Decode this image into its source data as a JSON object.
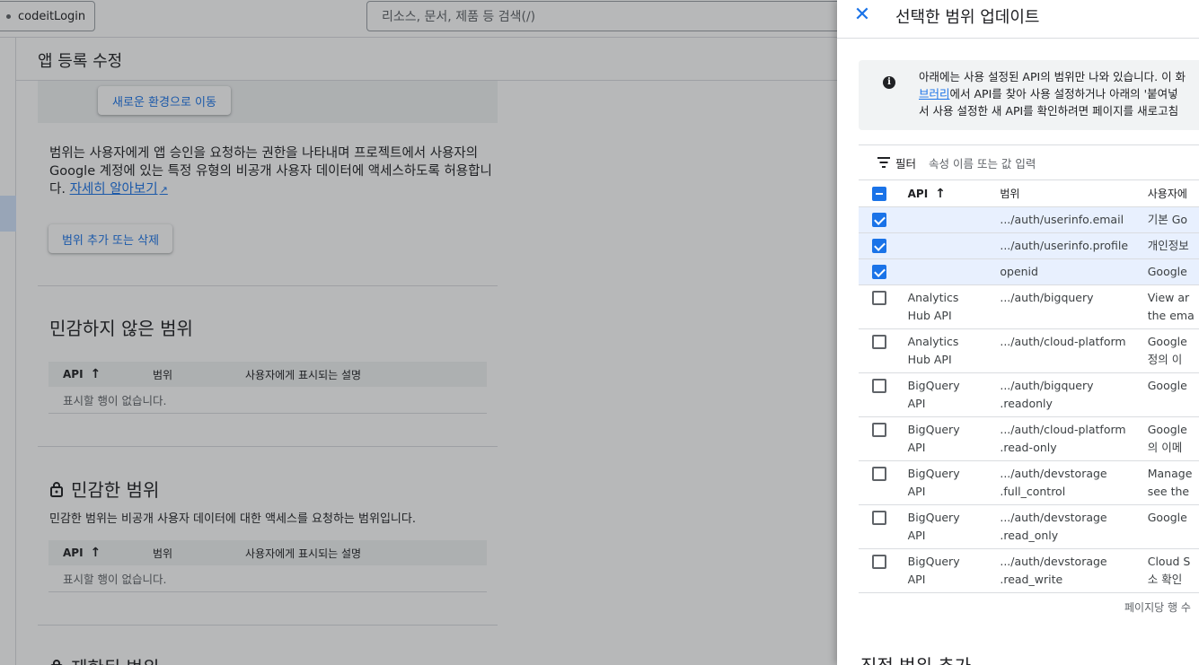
{
  "topbar": {
    "project_name": "codeitLogin",
    "search_placeholder": "리소스, 문서, 제품 등 검색(/)"
  },
  "page": {
    "title": "앱 등록 수정",
    "new_env_button": "새로운 환경으로 이동",
    "scope_description": "범위는 사용자에게 앱 승인을 요청하는 권한을 나타내며 프로젝트에서 사용자의 Google 계정에 있는 특정 유형의 비공개 사용자 데이터에 액세스하도록 허용합니다.",
    "learn_more": "자세히 알아보기",
    "add_remove_button": "범위 추가 또는 삭제",
    "nonsensitive": {
      "title": "민감하지 않은 범위",
      "headers": [
        "API",
        "범위",
        "사용자에게 표시되는 설명"
      ],
      "empty": "표시할 행이 없습니다."
    },
    "sensitive": {
      "title": "민감한 범위",
      "subtitle": "민감한 범위는 비공개 사용자 데이터에 대한 액세스를 요청하는 범위입니다.",
      "headers": [
        "API",
        "범위",
        "사용자에게 표시되는 설명"
      ],
      "empty": "표시할 행이 없습니다."
    },
    "restricted": {
      "title": "제한된 범위"
    }
  },
  "panel": {
    "title": "선택한 범위 업데이트",
    "info_line1": "아래에는 사용 설정된 API의 범위만 나와 있습니다. 이 화",
    "info_line2_link": "브러리",
    "info_line2_rest": "에서 API를 찾아 사용 설정하거나 아래의 '붙여넣",
    "info_line3": "서 사용 설정한 새 API를 확인하려면 페이지를 새로고침",
    "filter_label": "필터",
    "filter_placeholder": "속성 이름 또는 값 입력",
    "table_headers": {
      "api": "API",
      "scope": "범위",
      "desc": "사용자에"
    },
    "rows": [
      {
        "checked": true,
        "api1": "",
        "api2": "",
        "scope1": ".../auth/userinfo.email",
        "scope2": "",
        "desc1": "기본 Go",
        "desc2": ""
      },
      {
        "checked": true,
        "api1": "",
        "api2": "",
        "scope1": ".../auth/userinfo.profile",
        "scope2": "",
        "desc1": "개인정보",
        "desc2": ""
      },
      {
        "checked": true,
        "api1": "",
        "api2": "",
        "scope1": "openid",
        "scope2": "",
        "desc1": "Google",
        "desc2": ""
      },
      {
        "checked": false,
        "api1": "Analytics",
        "api2": "Hub API",
        "scope1": ".../auth/bigquery",
        "scope2": "",
        "desc1": "View ar",
        "desc2": "the ema"
      },
      {
        "checked": false,
        "api1": "Analytics",
        "api2": "Hub API",
        "scope1": ".../auth/cloud-platform",
        "scope2": "",
        "desc1": "Google",
        "desc2": "정의 이"
      },
      {
        "checked": false,
        "api1": "BigQuery",
        "api2": "API",
        "scope1": ".../auth/bigquery",
        "scope2": ".readonly",
        "desc1": "Google",
        "desc2": ""
      },
      {
        "checked": false,
        "api1": "BigQuery",
        "api2": "API",
        "scope1": ".../auth/cloud-platform",
        "scope2": ".read-only",
        "desc1": "Google",
        "desc2": "의 이메"
      },
      {
        "checked": false,
        "api1": "BigQuery",
        "api2": "API",
        "scope1": ".../auth/devstorage",
        "scope2": ".full_control",
        "desc1": "Manage",
        "desc2": "see the"
      },
      {
        "checked": false,
        "api1": "BigQuery",
        "api2": "API",
        "scope1": ".../auth/devstorage",
        "scope2": ".read_only",
        "desc1": "Google",
        "desc2": ""
      },
      {
        "checked": false,
        "api1": "BigQuery",
        "api2": "API",
        "scope1": ".../auth/devstorage",
        "scope2": ".read_write",
        "desc1": "Cloud S",
        "desc2": "소 확인"
      }
    ],
    "pager_text": "페이지당 행 수",
    "manual_title": "직접 범위 추가"
  },
  "colors": {
    "accent": "#1a73e8",
    "scrim": "rgba(32,33,36,0.32)"
  }
}
